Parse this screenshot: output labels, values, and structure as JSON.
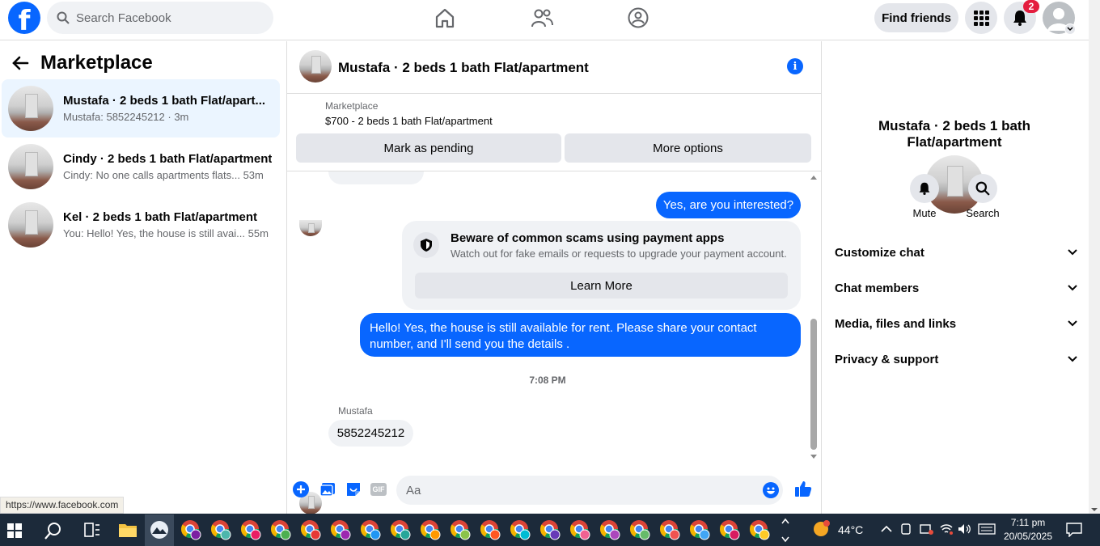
{
  "header": {
    "search_placeholder": "Search Facebook",
    "find_friends": "Find friends",
    "notification_count": "2",
    "logo_letter": "f"
  },
  "left": {
    "title": "Marketplace",
    "conversations": [
      {
        "title": "Mustafa · 2 beds 1 bath Flat/apart...",
        "preview": "Mustafa: 5852245212 · 3m"
      },
      {
        "title": "Cindy · 2 beds 1 bath Flat/apartment",
        "preview": "Cindy: No one calls apartments flats...",
        "time": "53m"
      },
      {
        "title": "Kel · 2 beds 1 bath Flat/apartment",
        "preview": "You: Hello! Yes, the house is still avai...",
        "time": "55m"
      }
    ]
  },
  "chat": {
    "title": "Mustafa · 2 beds 1 bath Flat/apartment",
    "listing_source": "Marketplace",
    "listing_text": "$700 - 2 beds 1 bath Flat/apartment",
    "mark_pending": "Mark as pending",
    "more_options": "More options",
    "msg_out_1": "Yes, are you interested?",
    "scam_title": "Beware of common scams using payment apps",
    "scam_text": "Watch out for fake emails or requests to upgrade your payment account.",
    "learn_more": "Learn More",
    "msg_out_2": "Hello! Yes, the house is still available for rent. Please share your contact number, and I'll send you the details .",
    "timestamp": "7:08 PM",
    "sender_name": "Mustafa",
    "msg_in": "5852245212",
    "composer_placeholder": "Aa",
    "gif_label": "GIF"
  },
  "right": {
    "title": "Mustafa · 2 beds 1 bath Flat/apartment",
    "mute": "Mute",
    "search": "Search",
    "sections": [
      "Customize chat",
      "Chat members",
      "Media, files and links",
      "Privacy & support"
    ]
  },
  "status_url": "https://www.facebook.com",
  "taskbar": {
    "temperature": "44°C",
    "time": "7:11 pm",
    "date": "20/05/2025"
  },
  "colors": {
    "accent": "#0866ff",
    "badge": "#e41e3f",
    "active_row": "#ebf5ff"
  }
}
